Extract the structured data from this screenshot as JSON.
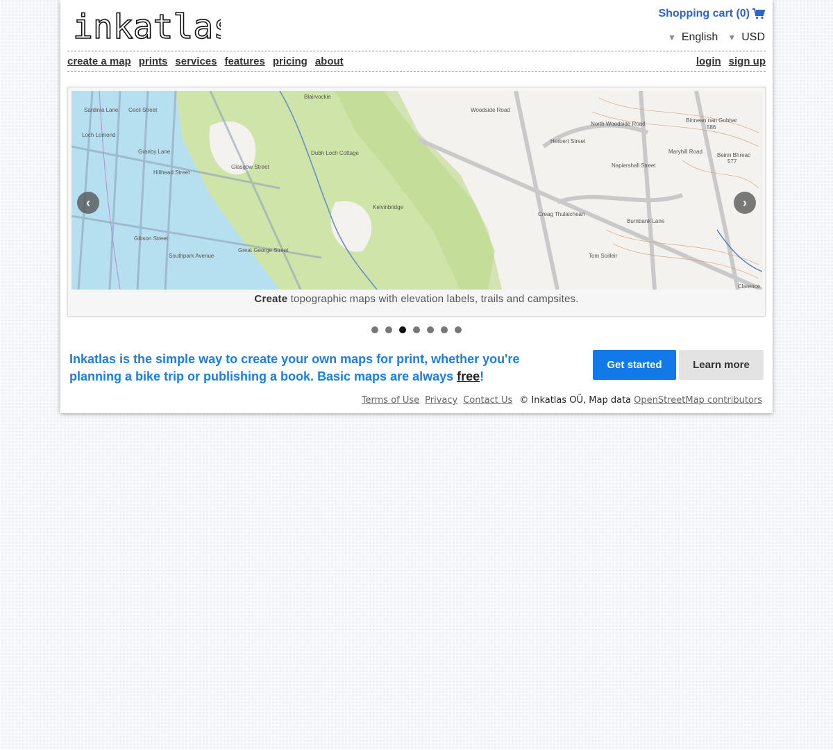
{
  "brand": {
    "logo_text": "inkatlas"
  },
  "header": {
    "cart_label": "Shopping cart (0)",
    "language": "English",
    "currency": "USD"
  },
  "nav": {
    "left": [
      {
        "label": "create a map"
      },
      {
        "label": "prints"
      },
      {
        "label": "services"
      },
      {
        "label": "features"
      },
      {
        "label": "pricing"
      },
      {
        "label": "about"
      }
    ],
    "right": [
      {
        "label": "login"
      },
      {
        "label": "sign up"
      }
    ]
  },
  "slider": {
    "caption_bold": "Create",
    "caption_rest": " topographic maps with elevation labels, trails and campsites.",
    "map_labels": {
      "blairvockie": "Blairvockie",
      "loch_lomond": "Loch Lomond",
      "dubh_loch_cottage": "Dubh Loch Cottage",
      "kelvinbridge": "Kelvinbridge",
      "north_woodside": "North Woodside Road",
      "binnean": "Binnean nan Gobhar",
      "binnean_elev": "586",
      "beinn": "Beinn Bhreac",
      "beinn_elev": "577",
      "creag": "Creag Thulaichean",
      "tom": "Tom Soilleir",
      "burnbank": "Burnbank Lane",
      "clarence": "Clarence",
      "glasgow_street": "Glasgow Street",
      "great_george": "Great George Street",
      "gibson": "Gibson Street",
      "sardinia": "Sardinia Lane",
      "cecil": "Cecil Street",
      "granby": "Granby Lane",
      "hillhead": "Hillhead Street",
      "southpark": "Southpark Avenue",
      "woodside": "Woodside Road",
      "herbert": "Herbert Street",
      "maryhill": "Maryhill Road",
      "napiershall": "Napiershall Street"
    },
    "dots_total": 7,
    "active_dot": 3
  },
  "cta": {
    "tagline_text": "Inkatlas is the simple way to create your own maps for print, whether you're planning a bike trip or publishing a book. Basic maps are always ",
    "tagline_link": "free",
    "tagline_end": "!",
    "get_started": "Get started",
    "learn_more": "Learn more"
  },
  "footer": {
    "terms": "Terms of Use",
    "privacy": "Privacy",
    "contact": "Contact Us",
    "copyright": "© Inkatlas OÜ, Map data",
    "osm": "OpenStreetMap contributors"
  },
  "colors": {
    "accent": "#1279e9",
    "cart": "#2f63c7",
    "tagline": "#1a7fe0",
    "water": "#b6dff0",
    "park": "#cfe4a8"
  }
}
